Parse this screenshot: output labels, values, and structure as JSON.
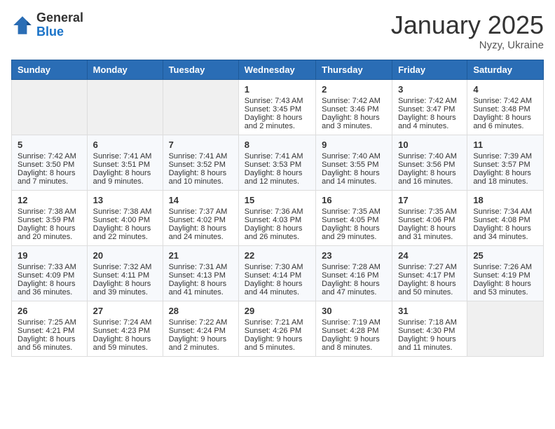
{
  "header": {
    "logo": {
      "line1": "General",
      "line2": "Blue"
    },
    "title": "January 2025",
    "location": "Nyzy, Ukraine"
  },
  "weekdays": [
    "Sunday",
    "Monday",
    "Tuesday",
    "Wednesday",
    "Thursday",
    "Friday",
    "Saturday"
  ],
  "weeks": [
    [
      {
        "day": "",
        "sunrise": "",
        "sunset": "",
        "daylight": ""
      },
      {
        "day": "",
        "sunrise": "",
        "sunset": "",
        "daylight": ""
      },
      {
        "day": "",
        "sunrise": "",
        "sunset": "",
        "daylight": ""
      },
      {
        "day": "1",
        "sunrise": "Sunrise: 7:43 AM",
        "sunset": "Sunset: 3:45 PM",
        "daylight": "Daylight: 8 hours and 2 minutes."
      },
      {
        "day": "2",
        "sunrise": "Sunrise: 7:42 AM",
        "sunset": "Sunset: 3:46 PM",
        "daylight": "Daylight: 8 hours and 3 minutes."
      },
      {
        "day": "3",
        "sunrise": "Sunrise: 7:42 AM",
        "sunset": "Sunset: 3:47 PM",
        "daylight": "Daylight: 8 hours and 4 minutes."
      },
      {
        "day": "4",
        "sunrise": "Sunrise: 7:42 AM",
        "sunset": "Sunset: 3:48 PM",
        "daylight": "Daylight: 8 hours and 6 minutes."
      }
    ],
    [
      {
        "day": "5",
        "sunrise": "Sunrise: 7:42 AM",
        "sunset": "Sunset: 3:50 PM",
        "daylight": "Daylight: 8 hours and 7 minutes."
      },
      {
        "day": "6",
        "sunrise": "Sunrise: 7:41 AM",
        "sunset": "Sunset: 3:51 PM",
        "daylight": "Daylight: 8 hours and 9 minutes."
      },
      {
        "day": "7",
        "sunrise": "Sunrise: 7:41 AM",
        "sunset": "Sunset: 3:52 PM",
        "daylight": "Daylight: 8 hours and 10 minutes."
      },
      {
        "day": "8",
        "sunrise": "Sunrise: 7:41 AM",
        "sunset": "Sunset: 3:53 PM",
        "daylight": "Daylight: 8 hours and 12 minutes."
      },
      {
        "day": "9",
        "sunrise": "Sunrise: 7:40 AM",
        "sunset": "Sunset: 3:55 PM",
        "daylight": "Daylight: 8 hours and 14 minutes."
      },
      {
        "day": "10",
        "sunrise": "Sunrise: 7:40 AM",
        "sunset": "Sunset: 3:56 PM",
        "daylight": "Daylight: 8 hours and 16 minutes."
      },
      {
        "day": "11",
        "sunrise": "Sunrise: 7:39 AM",
        "sunset": "Sunset: 3:57 PM",
        "daylight": "Daylight: 8 hours and 18 minutes."
      }
    ],
    [
      {
        "day": "12",
        "sunrise": "Sunrise: 7:38 AM",
        "sunset": "Sunset: 3:59 PM",
        "daylight": "Daylight: 8 hours and 20 minutes."
      },
      {
        "day": "13",
        "sunrise": "Sunrise: 7:38 AM",
        "sunset": "Sunset: 4:00 PM",
        "daylight": "Daylight: 8 hours and 22 minutes."
      },
      {
        "day": "14",
        "sunrise": "Sunrise: 7:37 AM",
        "sunset": "Sunset: 4:02 PM",
        "daylight": "Daylight: 8 hours and 24 minutes."
      },
      {
        "day": "15",
        "sunrise": "Sunrise: 7:36 AM",
        "sunset": "Sunset: 4:03 PM",
        "daylight": "Daylight: 8 hours and 26 minutes."
      },
      {
        "day": "16",
        "sunrise": "Sunrise: 7:35 AM",
        "sunset": "Sunset: 4:05 PM",
        "daylight": "Daylight: 8 hours and 29 minutes."
      },
      {
        "day": "17",
        "sunrise": "Sunrise: 7:35 AM",
        "sunset": "Sunset: 4:06 PM",
        "daylight": "Daylight: 8 hours and 31 minutes."
      },
      {
        "day": "18",
        "sunrise": "Sunrise: 7:34 AM",
        "sunset": "Sunset: 4:08 PM",
        "daylight": "Daylight: 8 hours and 34 minutes."
      }
    ],
    [
      {
        "day": "19",
        "sunrise": "Sunrise: 7:33 AM",
        "sunset": "Sunset: 4:09 PM",
        "daylight": "Daylight: 8 hours and 36 minutes."
      },
      {
        "day": "20",
        "sunrise": "Sunrise: 7:32 AM",
        "sunset": "Sunset: 4:11 PM",
        "daylight": "Daylight: 8 hours and 39 minutes."
      },
      {
        "day": "21",
        "sunrise": "Sunrise: 7:31 AM",
        "sunset": "Sunset: 4:13 PM",
        "daylight": "Daylight: 8 hours and 41 minutes."
      },
      {
        "day": "22",
        "sunrise": "Sunrise: 7:30 AM",
        "sunset": "Sunset: 4:14 PM",
        "daylight": "Daylight: 8 hours and 44 minutes."
      },
      {
        "day": "23",
        "sunrise": "Sunrise: 7:28 AM",
        "sunset": "Sunset: 4:16 PM",
        "daylight": "Daylight: 8 hours and 47 minutes."
      },
      {
        "day": "24",
        "sunrise": "Sunrise: 7:27 AM",
        "sunset": "Sunset: 4:17 PM",
        "daylight": "Daylight: 8 hours and 50 minutes."
      },
      {
        "day": "25",
        "sunrise": "Sunrise: 7:26 AM",
        "sunset": "Sunset: 4:19 PM",
        "daylight": "Daylight: 8 hours and 53 minutes."
      }
    ],
    [
      {
        "day": "26",
        "sunrise": "Sunrise: 7:25 AM",
        "sunset": "Sunset: 4:21 PM",
        "daylight": "Daylight: 8 hours and 56 minutes."
      },
      {
        "day": "27",
        "sunrise": "Sunrise: 7:24 AM",
        "sunset": "Sunset: 4:23 PM",
        "daylight": "Daylight: 8 hours and 59 minutes."
      },
      {
        "day": "28",
        "sunrise": "Sunrise: 7:22 AM",
        "sunset": "Sunset: 4:24 PM",
        "daylight": "Daylight: 9 hours and 2 minutes."
      },
      {
        "day": "29",
        "sunrise": "Sunrise: 7:21 AM",
        "sunset": "Sunset: 4:26 PM",
        "daylight": "Daylight: 9 hours and 5 minutes."
      },
      {
        "day": "30",
        "sunrise": "Sunrise: 7:19 AM",
        "sunset": "Sunset: 4:28 PM",
        "daylight": "Daylight: 9 hours and 8 minutes."
      },
      {
        "day": "31",
        "sunrise": "Sunrise: 7:18 AM",
        "sunset": "Sunset: 4:30 PM",
        "daylight": "Daylight: 9 hours and 11 minutes."
      },
      {
        "day": "",
        "sunrise": "",
        "sunset": "",
        "daylight": ""
      }
    ]
  ]
}
